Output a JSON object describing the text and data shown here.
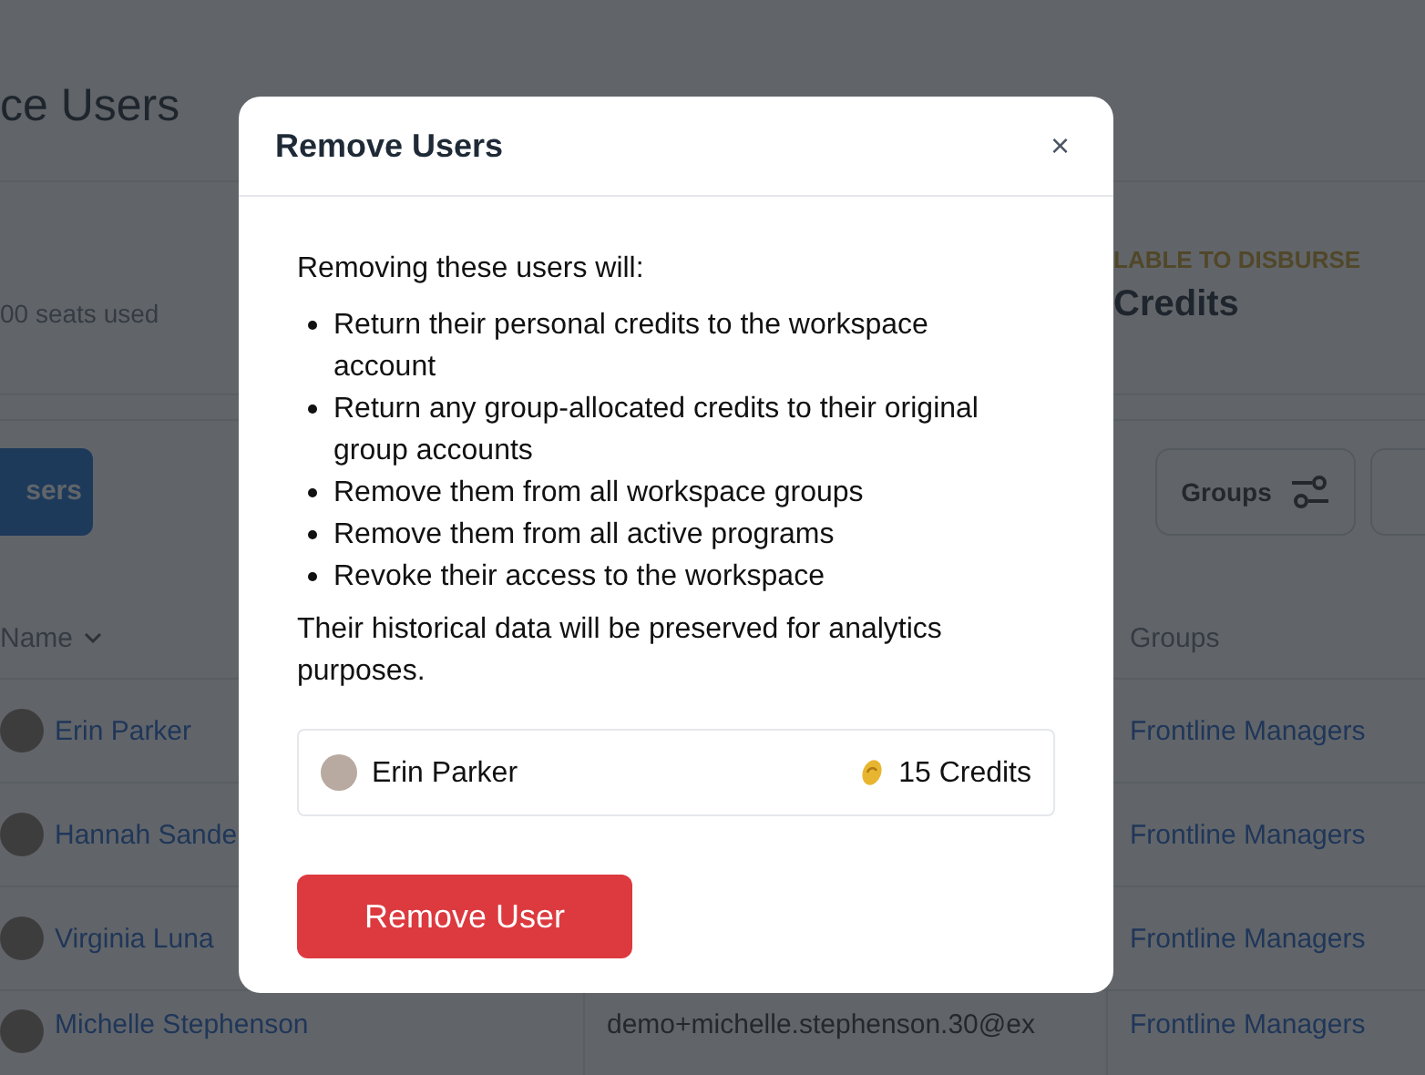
{
  "page": {
    "title": "ce Users",
    "seats": "00 seats used",
    "available_label": "LABLE TO DISBURSE",
    "available_value": "Credits",
    "primary_button": "sers",
    "groups_button": "Groups"
  },
  "table": {
    "columns": [
      {
        "label": "Name",
        "sortable": true
      },
      {
        "label": "Groups",
        "sortable": false
      }
    ],
    "rows": [
      {
        "name": "Erin Parker",
        "email": "",
        "group": "Frontline Managers"
      },
      {
        "name": "Hannah Sande",
        "email": "",
        "group": "Frontline Managers"
      },
      {
        "name": "Virginia Luna",
        "email": "",
        "group": "Frontline Managers"
      },
      {
        "name": "Michelle Stephenson",
        "email": "demo+michelle.stephenson.30@ex",
        "group": "Frontline Managers"
      }
    ]
  },
  "dialog": {
    "title": "Remove Users",
    "close": "×",
    "intro": "Removing these users will:",
    "effects": [
      "Return their personal credits to the workspace account",
      "Return any group-allocated credits to their original group accounts",
      "Remove them from all workspace groups",
      "Remove them from all active programs",
      "Revoke their access to the workspace"
    ],
    "note": "Their historical data will be preserved for analytics purposes.",
    "users": [
      {
        "name": "Erin Parker",
        "credits": "15 Credits"
      }
    ],
    "confirm_button": "Remove User"
  }
}
